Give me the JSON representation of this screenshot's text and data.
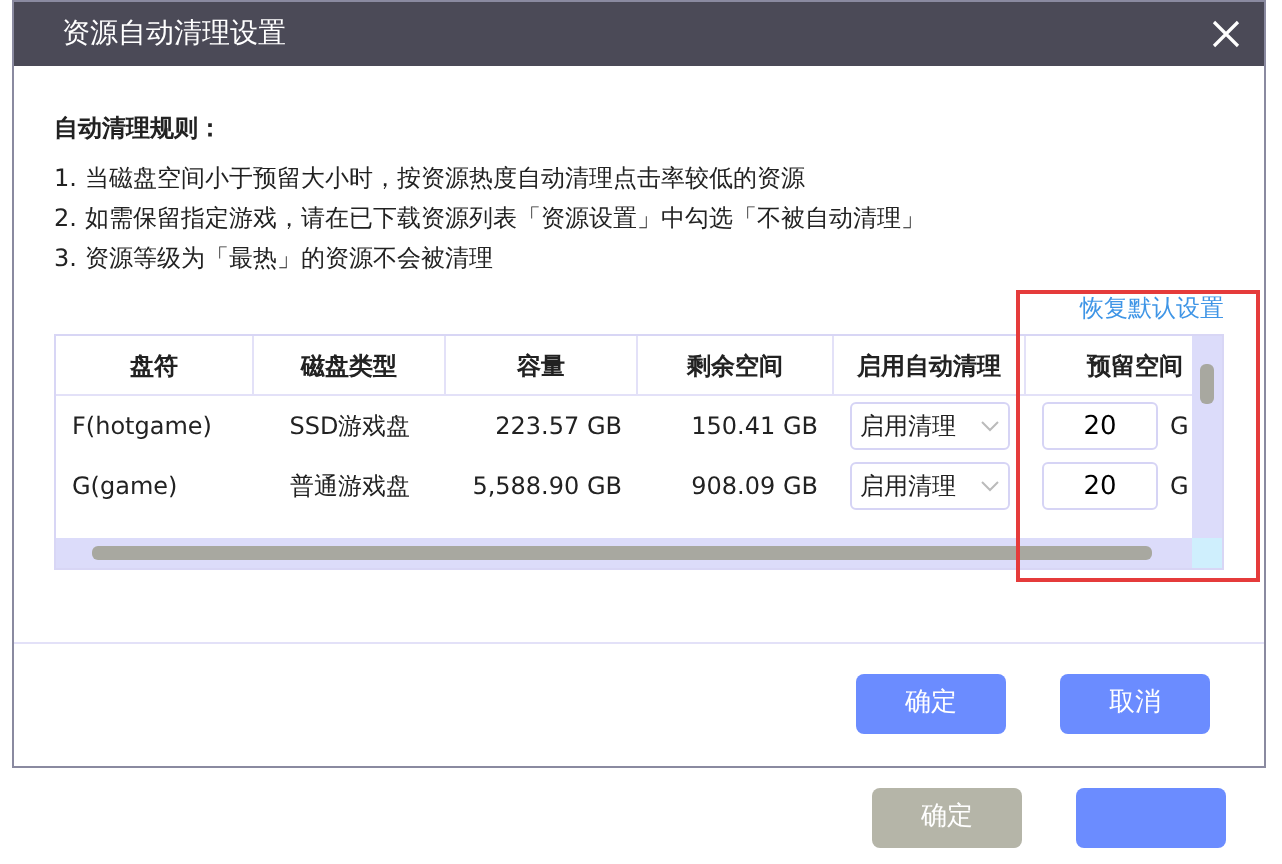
{
  "background_window": {
    "buttons": [
      {
        "label": "确定",
        "disabled": true
      },
      {
        "disabled": false
      }
    ]
  },
  "dialog": {
    "title": "资源自动清理设置",
    "rules_heading": "自动清理规则：",
    "rules": [
      "1. 当磁盘空间小于预留大小时，按资源热度自动清理点击率较低的资源",
      "2. 如需保留指定游戏，请在已下载资源列表「资源设置」中勾选「不被自动清理」",
      "3. 资源等级为「最热」的资源不会被清理"
    ],
    "restore_link": "恢复默认设置",
    "table": {
      "columns": [
        "盘符",
        "磁盘类型",
        "容量",
        "剩余空间",
        "启用自动清理",
        "预留空间"
      ],
      "rows": [
        {
          "drive": "F(hotgame)",
          "type": "SSD游戏盘",
          "capacity": "223.57 GB",
          "free": "150.41 GB",
          "cleanup": "启用清理",
          "reserve": "20",
          "unit": "G"
        },
        {
          "drive": "G(game)",
          "type": "普通游戏盘",
          "capacity": "5,588.90 GB",
          "free": "908.09 GB",
          "cleanup": "启用清理",
          "reserve": "20",
          "unit": "G"
        }
      ]
    },
    "buttons": [
      "确定",
      "取消"
    ]
  }
}
